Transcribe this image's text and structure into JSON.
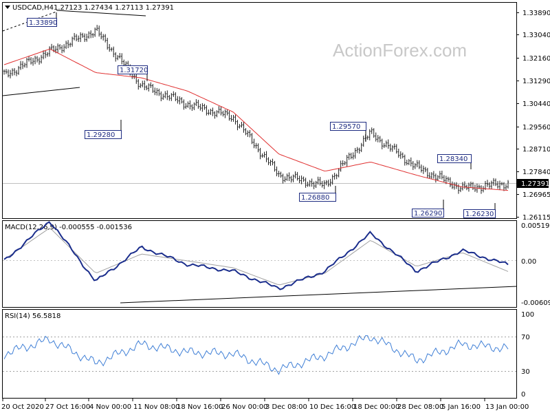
{
  "watermark": "ActionForex.com",
  "price_panel": {
    "header_symbol": "USDCAD,H4",
    "header_ohlc": "1.27123 1.27434 1.27113 1.27391",
    "price_axis_labels": [
      "1.33890",
      "1.33040",
      "1.32160",
      "1.31290",
      "1.30440",
      "1.29560",
      "1.28710",
      "1.27840",
      "1.26965",
      "1.26115"
    ],
    "current_price_label": "1.27391",
    "callouts": [
      {
        "text": "1.33890",
        "value": 1.3389,
        "type": "high"
      },
      {
        "text": "1.31720",
        "value": 1.3172,
        "type": "high"
      },
      {
        "text": "1.29280",
        "value": 1.2928,
        "type": "low"
      },
      {
        "text": "1.29570",
        "value": 1.2957,
        "type": "high"
      },
      {
        "text": "1.26880",
        "value": 1.2688,
        "type": "low"
      },
      {
        "text": "1.28340",
        "value": 1.2834,
        "type": "high"
      },
      {
        "text": "1.26290",
        "value": 1.2629,
        "type": "low"
      },
      {
        "text": "1.26230",
        "value": 1.2623,
        "type": "low"
      }
    ]
  },
  "macd_panel": {
    "header": "MACD(12,26,9) -0.000555 -0.001536",
    "axis_labels": [
      "0.005195",
      "0.00",
      "-0.006093"
    ]
  },
  "rsi_panel": {
    "header": "RSI(14) 56.5818",
    "axis_labels": [
      "100",
      "70",
      "30",
      "0"
    ]
  },
  "time_axis_labels": [
    "20 Oct 2020",
    "27 Oct 16:00",
    "4 Nov 00:00",
    "11 Nov 08:00",
    "18 Nov 16:00",
    "26 Nov 00:00",
    "3 Dec 08:00",
    "10 Dec 16:00",
    "18 Dec 00:00",
    "28 Dec 08:00",
    "5 Jan 16:00",
    "13 Jan 00:00"
  ],
  "colors": {
    "price_bars": "#1a1a1a",
    "ma_line": "#e03030",
    "macd_line": "#1a2d8c",
    "signal_line": "#a0a0a0",
    "rsi_line": "#3f7fd6",
    "callout_border": "#1c2a80"
  },
  "chart_data": [
    {
      "type": "line",
      "title": "USDCAD,H4",
      "ylim": [
        1.26115,
        1.3389
      ],
      "x": [
        "20 Oct 2020",
        "27 Oct 16:00",
        "4 Nov 00:00",
        "11 Nov 08:00",
        "18 Nov 16:00",
        "26 Nov 00:00",
        "3 Dec 08:00",
        "10 Dec 16:00",
        "18 Dec 00:00",
        "28 Dec 08:00",
        "5 Jan 16:00",
        "13 Jan 00:00"
      ],
      "series": [
        {
          "values": [
            1.315,
            1.324,
            1.332,
            1.311,
            1.304,
            1.299,
            1.277,
            1.273,
            1.293,
            1.28,
            1.272,
            1.2739
          ]
        },
        {
          "values": [
            1.319,
            1.325,
            1.316,
            1.314,
            1.309,
            1.301,
            1.285,
            1.2785,
            1.282,
            1.277,
            1.2725,
            1.2712
          ]
        }
      ]
    },
    {
      "type": "line",
      "title": "MACD(12,26,9)",
      "ylim": [
        -0.006093,
        0.005195
      ],
      "x": [
        "20 Oct 2020",
        "27 Oct 16:00",
        "4 Nov 00:00",
        "11 Nov 08:00",
        "18 Nov 16:00",
        "26 Nov 00:00",
        "3 Dec 08:00",
        "10 Dec 16:00",
        "18 Dec 00:00",
        "28 Dec 08:00",
        "5 Jan 16:00",
        "13 Jan 00:00"
      ],
      "series": [
        {
          "values": [
            0.0,
            0.0058,
            -0.003,
            0.002,
            -0.0005,
            -0.0015,
            -0.004,
            -0.0015,
            0.004,
            -0.0015,
            0.0015,
            -0.000555
          ]
        },
        {
          "values": [
            0.0002,
            0.0048,
            -0.0018,
            0.001,
            0.0,
            -0.001,
            -0.0035,
            -0.0018,
            0.003,
            -0.0008,
            0.0012,
            -0.001536
          ]
        }
      ]
    },
    {
      "type": "line",
      "title": "RSI(14)",
      "ylim": [
        0,
        100
      ],
      "x": [
        "20 Oct 2020",
        "27 Oct 16:00",
        "4 Nov 00:00",
        "11 Nov 08:00",
        "18 Nov 16:00",
        "26 Nov 00:00",
        "3 Dec 08:00",
        "10 Dec 16:00",
        "18 Dec 00:00",
        "28 Dec 08:00",
        "5 Jan 16:00",
        "13 Jan 00:00"
      ],
      "series": [
        {
          "values": [
            50,
            68,
            38,
            62,
            52,
            50,
            30,
            48,
            72,
            42,
            62,
            56.58
          ]
        }
      ]
    }
  ]
}
